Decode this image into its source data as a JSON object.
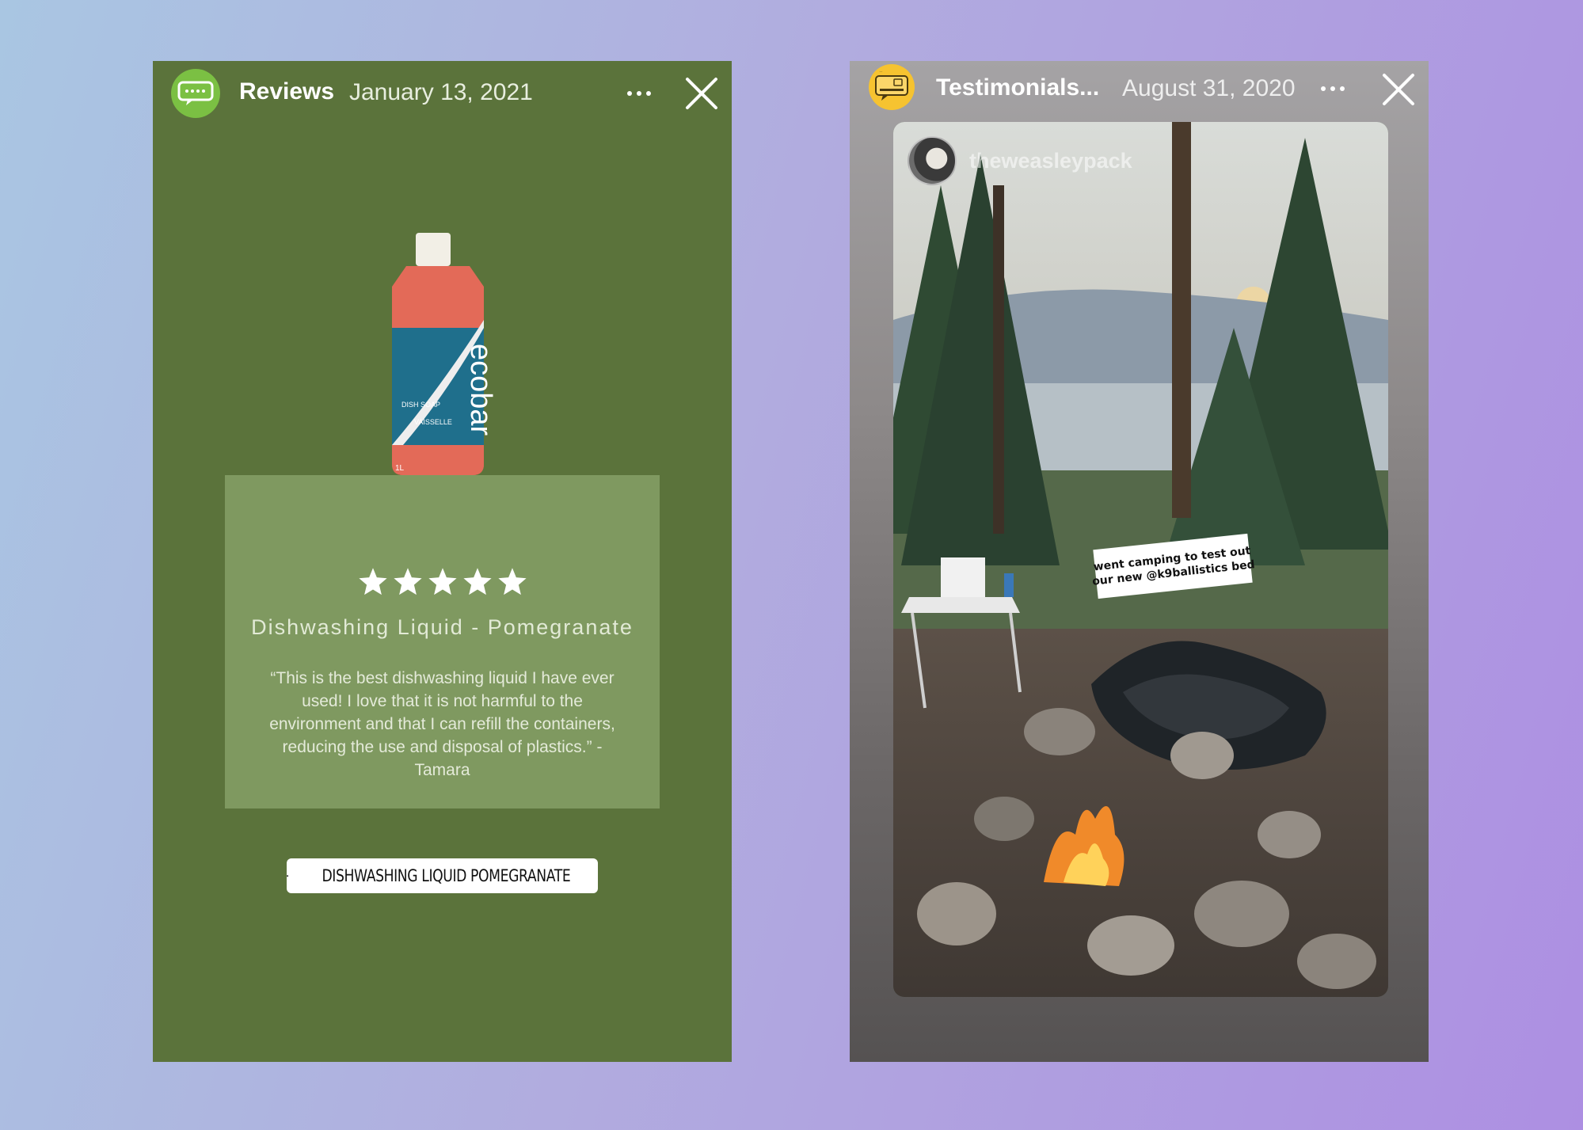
{
  "stories": {
    "left": {
      "account_name": "Reviews",
      "date": "January 13, 2021",
      "avatar_icon": "chat-bubble-icon",
      "avatar_color": "#7bc043",
      "background_color": "#5b733b",
      "bottle": {
        "brand": "ecobar",
        "line1": "DISH SOAP",
        "line2": "VAISSELLE",
        "volume": "1L"
      },
      "rating": {
        "stars": 5,
        "max": 5
      },
      "product_name": "Dishwashing Liquid - Pomegranate",
      "review_text": "“This is the best dishwashing liquid I have ever used! I love that it is not harmful to the environment and that I can refill the containers, reducing the use and disposal of plastics.” - Tamara",
      "product_tag": "DISHWASHING LIQUID POMEGRANATE"
    },
    "right": {
      "account_name": "Testimonials...",
      "date": "August 31, 2020",
      "avatar_icon": "testimonials-speech-bubble-icon",
      "avatar_color": "#f6c330",
      "photo": {
        "username": "theweasleypack",
        "sticker_line1": "went camping to test out",
        "sticker_line2": "our new @k9ballistics bed"
      }
    }
  }
}
